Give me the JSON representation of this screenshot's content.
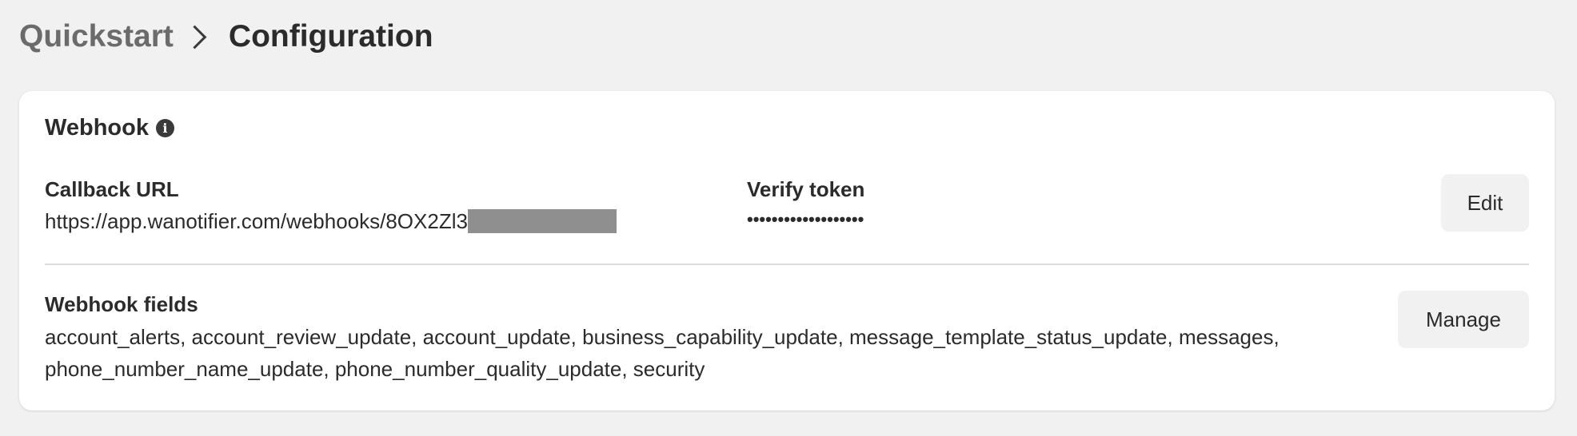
{
  "breadcrumb": {
    "parent": "Quickstart",
    "current": "Configuration"
  },
  "webhook": {
    "title": "Webhook",
    "info_icon": "info-icon",
    "callback": {
      "label": "Callback URL",
      "value": "https://app.wanotifier.com/webhooks/8OX2Zl3"
    },
    "verify": {
      "label": "Verify token",
      "value": "•••••••••••••••••••"
    },
    "edit_label": "Edit",
    "fields": {
      "label": "Webhook fields",
      "value": "account_alerts, account_review_update, account_update, business_capability_update, message_template_status_update, messages, phone_number_name_update, phone_number_quality_update, security"
    },
    "manage_label": "Manage"
  },
  "colors": {
    "background": "#f1f1f1",
    "card": "#ffffff",
    "button": "#f1f1f1",
    "redaction": "#8f8f8f"
  }
}
